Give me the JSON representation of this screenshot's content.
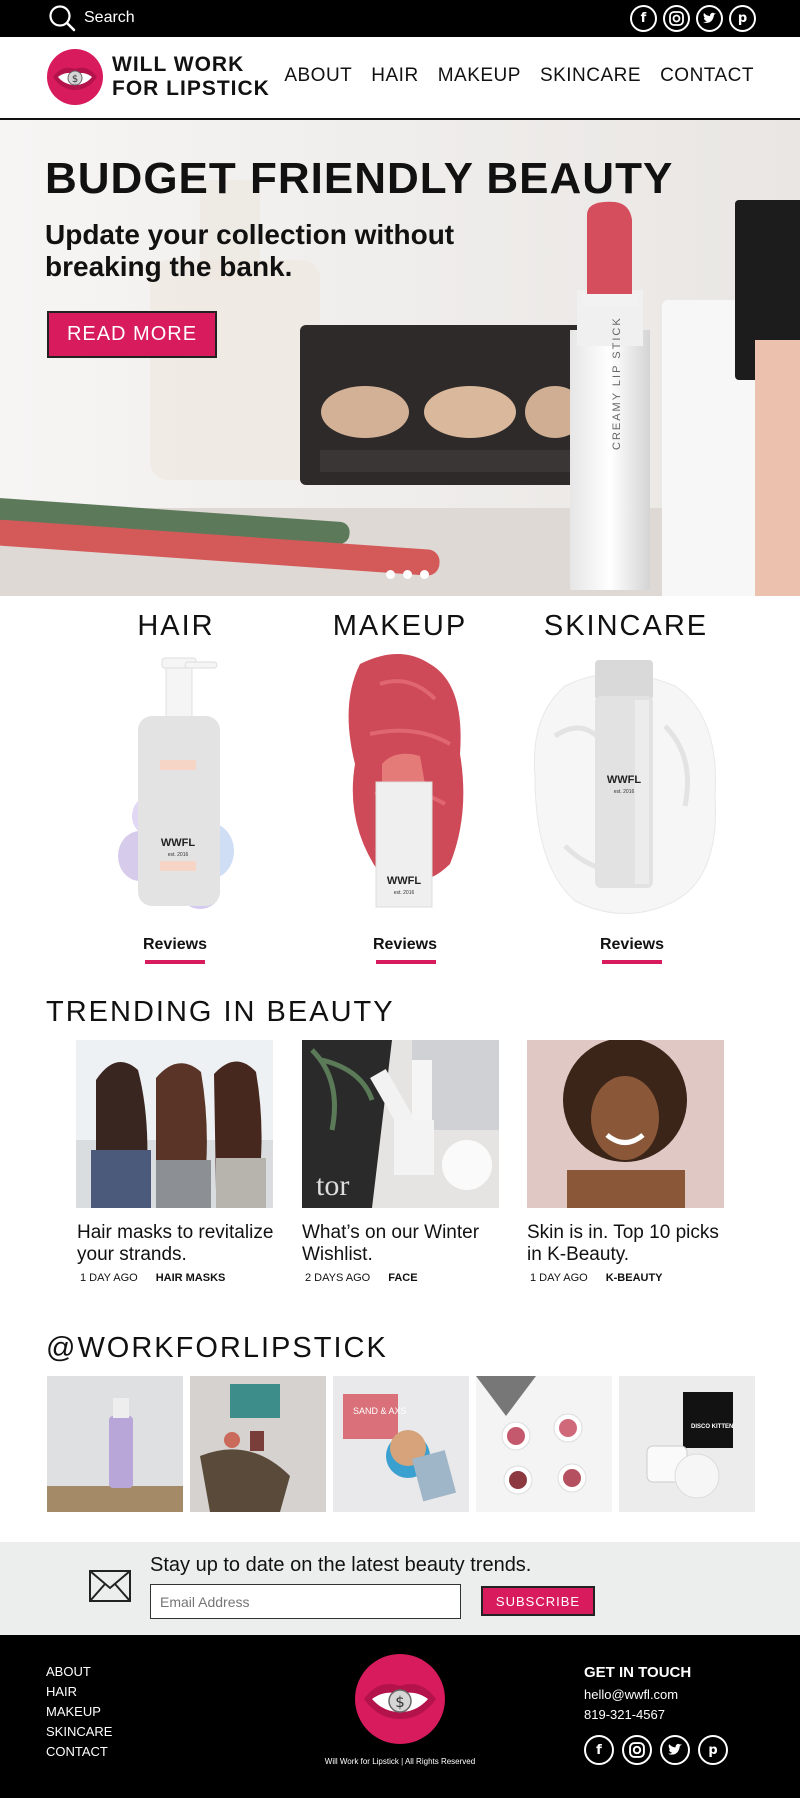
{
  "topbar": {
    "search_label": "Search",
    "social": [
      "facebook-icon",
      "instagram-icon",
      "twitter-icon",
      "pinterest-icon"
    ]
  },
  "brand": {
    "name_line1": "WILL WORK",
    "name_line2": "FOR LIPSTICK",
    "accent": "#d81b5c"
  },
  "nav": {
    "items": [
      "ABOUT",
      "HAIR",
      "MAKEUP",
      "SKINCARE",
      "CONTACT"
    ]
  },
  "hero": {
    "title": "BUDGET FRIENDLY BEAUTY",
    "subtitle": "Update your collection without breaking the bank.",
    "button": "READ MORE",
    "lipstick_label": "CREAMY LIP STICK",
    "slide_count": 3
  },
  "categories": [
    {
      "title": "HAIR",
      "brand": "WWFL",
      "est": "est. 2016",
      "link": "Reviews"
    },
    {
      "title": "MAKEUP",
      "brand": "WWFL",
      "est": "est. 2016",
      "link": "Reviews"
    },
    {
      "title": "SKINCARE",
      "brand": "WWFL",
      "est": "est. 2016",
      "link": "Reviews"
    }
  ],
  "trending": {
    "title": "TRENDING IN BEAUTY",
    "items": [
      {
        "title": "Hair masks to revitalize your strands.",
        "time": "1 DAY AGO",
        "tag": "HAIR MASKS"
      },
      {
        "title": "What’s on our Winter Wishlist.",
        "time": "2 DAYS AGO",
        "tag": "FACE"
      },
      {
        "title": "Skin is in. Top 10 picks in K-Beauty.",
        "time": "1 DAY AGO",
        "tag": "K-BEAUTY"
      }
    ]
  },
  "instagram": {
    "title": "@WORKFORLIPSTICK",
    "sand_label": "SAND & AXS",
    "disco_label": "DISCO KITTEN"
  },
  "newsletter": {
    "text": "Stay up to date on the latest beauty trends.",
    "placeholder": "Email Address",
    "button": "SUBSCRIBE"
  },
  "footer": {
    "links": [
      "ABOUT",
      "HAIR",
      "MAKEUP",
      "SKINCARE",
      "CONTACT"
    ],
    "copyright": "Will Work for Lipstick | All Rights Reserved",
    "contact_title": "GET IN TOUCH",
    "email": "hello@wwfl.com",
    "phone": "819-321-4567"
  }
}
